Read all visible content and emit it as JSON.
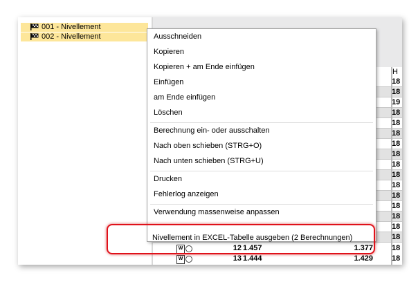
{
  "tree": {
    "items": [
      {
        "label": "001 - Nivellement"
      },
      {
        "label": "002 - Nivellement"
      }
    ]
  },
  "grid": {
    "header_h": "H",
    "h_values": [
      "18",
      "18",
      "19",
      "18",
      "18",
      "18",
      "18",
      "18",
      "18",
      "18",
      "18",
      "18",
      "18",
      "18",
      "18",
      "18"
    ],
    "visible_rows": [
      {
        "icon": "W",
        "number": "12",
        "value1": "1.457",
        "value2": "1.377",
        "h": "18"
      },
      {
        "icon": "W",
        "number": "13",
        "value1": "1.444",
        "value2": "1.429",
        "h": "18"
      }
    ]
  },
  "context_menu": {
    "groups": [
      [
        "Ausschneiden",
        "Kopieren",
        "Kopieren + am Ende einfügen",
        "Einfügen",
        "am Ende einfügen",
        "Löschen"
      ],
      [
        "Berechnung ein- oder ausschalten",
        "Nach oben schieben (STRG+O)",
        "Nach unten schieben (STRG+U)"
      ],
      [
        "Drucken",
        "Fehlerlog anzeigen"
      ],
      [
        "Verwendung massenweise anpassen"
      ]
    ],
    "highlighted_item": "Nivellement in EXCEL-Tabelle ausgeben (2 Berechnungen)"
  },
  "colors": {
    "selection": "#fde69a",
    "highlight_border": "#e0111a",
    "grid_alt_row": "#e2e2e2"
  }
}
